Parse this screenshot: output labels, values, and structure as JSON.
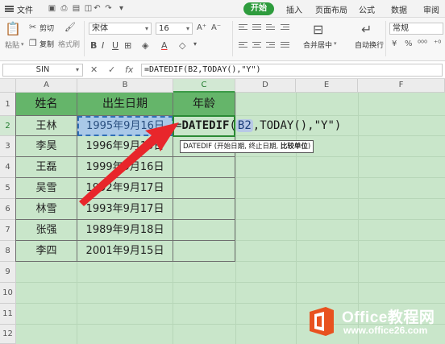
{
  "menubar": {
    "file": "文件",
    "tabs": [
      "开始",
      "插入",
      "页面布局",
      "公式",
      "数据",
      "审阅"
    ],
    "active_tab": "开始"
  },
  "ribbon": {
    "paste": "粘贴",
    "cut": "剪切",
    "copy": "复制",
    "format_painter": "格式刷",
    "font_name": "宋体",
    "font_size": "16",
    "merge_center": "合并居中",
    "wrap_text": "自动换行",
    "number_format": "常规"
  },
  "formula_bar": {
    "name_box": "SIN",
    "formula": "=DATEDIF(B2,TODAY(),\"Y\")"
  },
  "columns": [
    "A",
    "B",
    "C",
    "D",
    "E",
    "F"
  ],
  "rows": [
    "1",
    "2",
    "3",
    "4",
    "5",
    "6",
    "7",
    "8",
    "9",
    "10",
    "11",
    "12"
  ],
  "table": {
    "headers": [
      "姓名",
      "出生日期",
      "年龄"
    ],
    "rows": [
      [
        "王林",
        "1995年9月16日"
      ],
      [
        "李昊",
        "1996年9月15日"
      ],
      [
        "王磊",
        "1999年9月16日"
      ],
      [
        "吴雪",
        "1992年9月17日"
      ],
      [
        "林雪",
        "1993年9月17日"
      ],
      [
        "张强",
        "1989年9月18日"
      ],
      [
        "李四",
        "2001年9月15日"
      ]
    ]
  },
  "formula_cell": {
    "eq": "=",
    "fname": "DATEDIF",
    "open": "(",
    "ref": "B2",
    "rest": ",TODAY(),\"Y\"",
    "close": ")"
  },
  "tooltip": {
    "prefix": "DATEDIF (开始日期, 终止日期, ",
    "bold": "比较单位",
    "suffix": ")"
  },
  "watermark": {
    "title": "Office教程网",
    "url": "www.office26.com"
  },
  "colors": {
    "accent": "#2e9c3d",
    "header_fill": "#65b56a",
    "sheet_bg": "#c9e6ca",
    "arrow": "#e8262b",
    "logo": "#e8521f"
  }
}
